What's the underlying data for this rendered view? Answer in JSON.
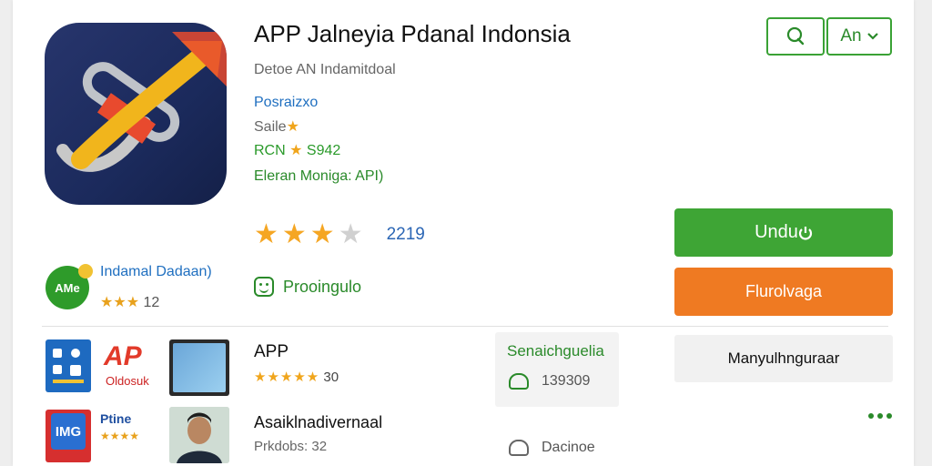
{
  "header": {
    "title": "APP Jalneyia Pdanal Indonsia",
    "developer": "Detoe AN Indamitdoal",
    "meta": {
      "category": "Posraizxo",
      "sale": "Saile",
      "rating_line": "RCN",
      "rating_value": "S942",
      "requirement": "Eleran Moniga: API)"
    }
  },
  "toolbar": {
    "language_label": "An"
  },
  "rating": {
    "stars_filled": "★★★",
    "stars_half": "★",
    "count": "2219"
  },
  "actions": {
    "primary_label": "Undu",
    "secondary_label": "Flurolvaga"
  },
  "publisher": {
    "badge_text": "AMe",
    "name": "Indamal Dadaan)",
    "rating_stars": "★★★",
    "rating_value": "12"
  },
  "feature": {
    "label": "Prooingulo"
  },
  "related": [
    {
      "thumb_big": "AP",
      "thumb_small": "Oldosuk",
      "title": "APP",
      "stars": "★★★★★",
      "rating": "30"
    },
    {
      "thumb_big": "IMG",
      "thumb_label": "Ptine",
      "thumb_stars": "★★★★",
      "title": "Asaiklnadivernaal",
      "rating": "Prkdobs: 32"
    }
  ],
  "side_panel": {
    "title": "Senaichguelia",
    "value1": "139309",
    "value2": "Dacinoe"
  },
  "manage_label": "Manyulhnguraar",
  "colors": {
    "accent_green": "#3ea535",
    "accent_orange": "#ef7a22",
    "link_blue": "#1f6fc0",
    "star_yellow": "#f5a623"
  }
}
